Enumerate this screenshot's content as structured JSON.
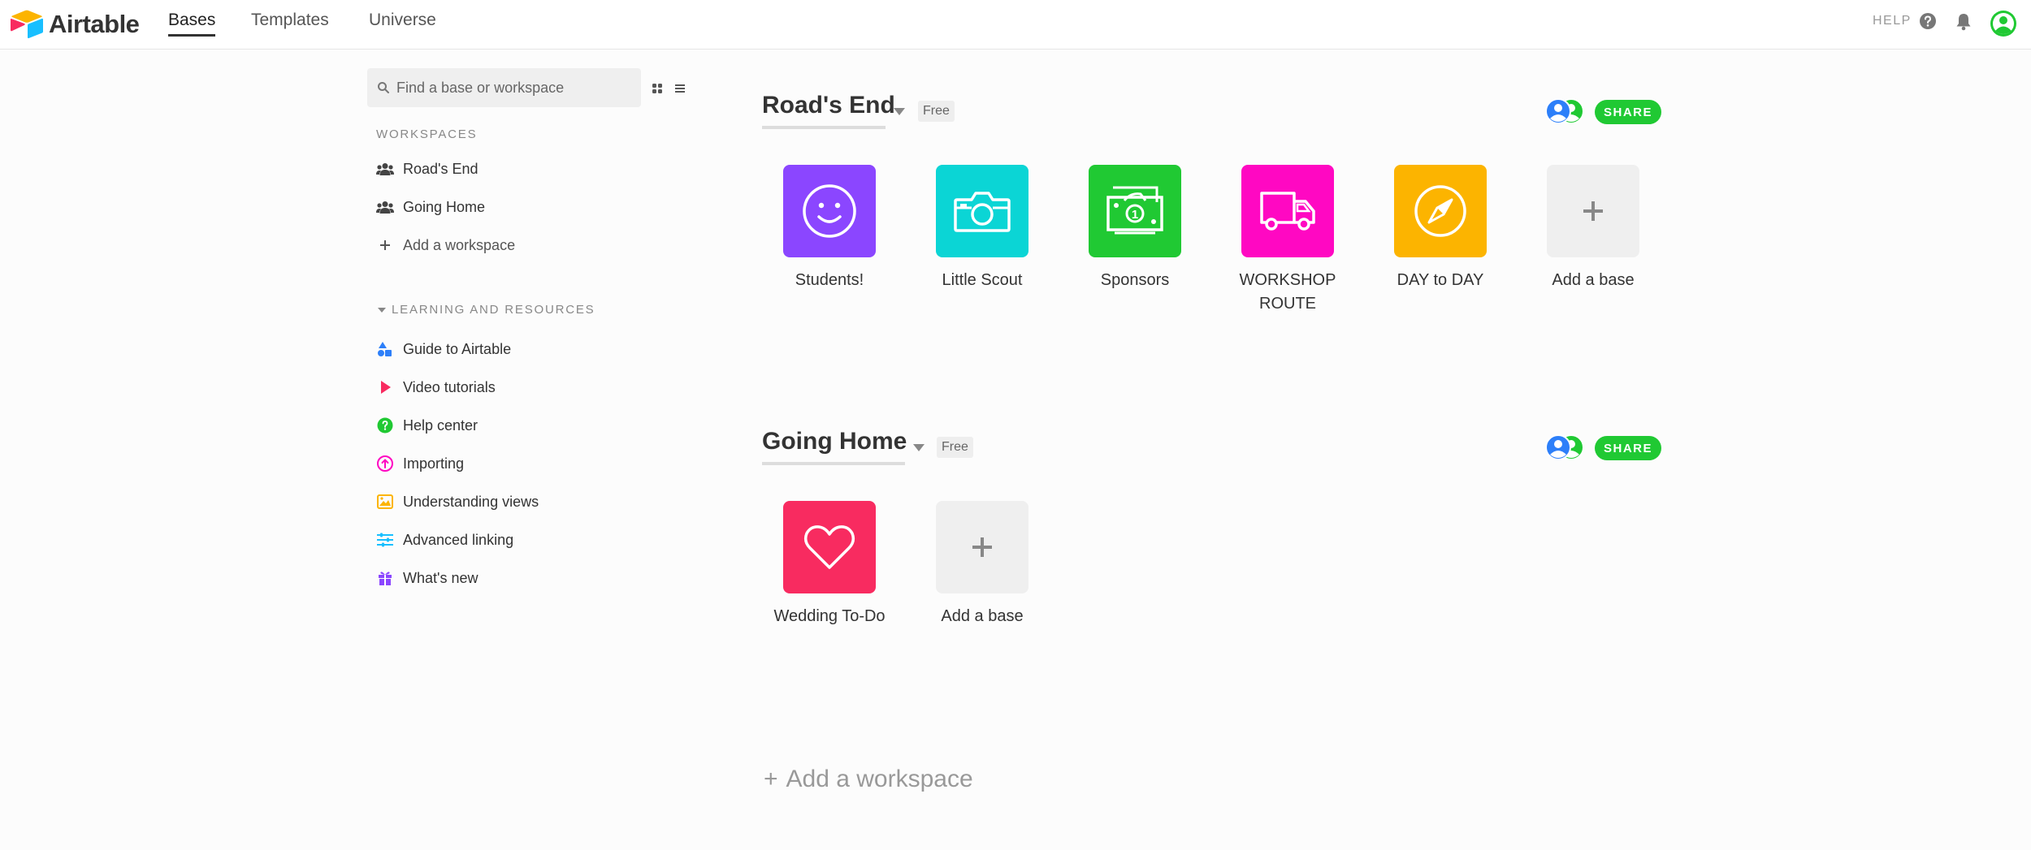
{
  "app": {
    "name": "Airtable",
    "accent": "#2d7ff9"
  },
  "nav": {
    "tabs": [
      {
        "label": "Bases",
        "active": true
      },
      {
        "label": "Templates",
        "active": false
      },
      {
        "label": "Universe",
        "active": false
      }
    ],
    "help_label": "HELP"
  },
  "sidebar": {
    "search_placeholder": "Find a base or workspace",
    "workspaces_heading": "WORKSPACES",
    "workspaces": [
      {
        "label": "Road's End",
        "icon": "users-icon"
      },
      {
        "label": "Going Home",
        "icon": "users-icon"
      },
      {
        "label": "Add a workspace",
        "icon": "plus-icon"
      }
    ],
    "resources_heading": "LEARNING AND RESOURCES",
    "resources": [
      {
        "label": "Guide to Airtable",
        "icon": "shapes-icon",
        "color": "#2d7ff9"
      },
      {
        "label": "Video tutorials",
        "icon": "play-icon",
        "color": "#f82b60"
      },
      {
        "label": "Help center",
        "icon": "help-icon",
        "color": "#20c933"
      },
      {
        "label": "Importing",
        "icon": "upload-icon",
        "color": "#ff08c2"
      },
      {
        "label": "Understanding views",
        "icon": "views-icon",
        "color": "#fcb400"
      },
      {
        "label": "Advanced linking",
        "icon": "linking-icon",
        "color": "#18bfff"
      },
      {
        "label": "What's new",
        "icon": "gift-icon",
        "color": "#8b46ff"
      }
    ]
  },
  "workspaces": [
    {
      "name": "Road's End",
      "plan": "Free",
      "share_label": "SHARE",
      "bases": [
        {
          "name": "Students!",
          "color": "#8b46ff",
          "icon": "smile-icon"
        },
        {
          "name": "Little Scout",
          "color": "#0bd5d5",
          "icon": "camera-icon"
        },
        {
          "name": "Sponsors",
          "color": "#20c933",
          "icon": "money-icon"
        },
        {
          "name": "WORKSHOP ROUTE",
          "color": "#ff08c2",
          "icon": "truck-icon"
        },
        {
          "name": "DAY to DAY",
          "color": "#fcb400",
          "icon": "compass-icon"
        }
      ],
      "add_base_label": "Add a base"
    },
    {
      "name": "Going Home",
      "plan": "Free",
      "share_label": "SHARE",
      "bases": [
        {
          "name": "Wedding To-Do",
          "color": "#f82b60",
          "icon": "heart-icon"
        }
      ],
      "add_base_label": "Add a base"
    }
  ],
  "add_workspace_label": "Add a workspace"
}
